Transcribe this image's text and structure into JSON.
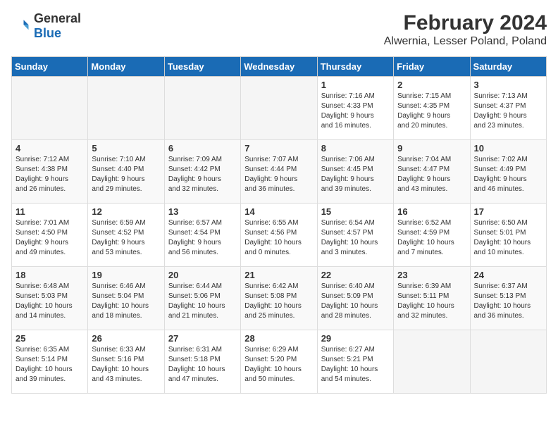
{
  "logo": {
    "text_general": "General",
    "text_blue": "Blue"
  },
  "title": "February 2024",
  "subtitle": "Alwernia, Lesser Poland, Poland",
  "days_of_week": [
    "Sunday",
    "Monday",
    "Tuesday",
    "Wednesday",
    "Thursday",
    "Friday",
    "Saturday"
  ],
  "weeks": [
    [
      {
        "day": "",
        "info": ""
      },
      {
        "day": "",
        "info": ""
      },
      {
        "day": "",
        "info": ""
      },
      {
        "day": "",
        "info": ""
      },
      {
        "day": "1",
        "info": "Sunrise: 7:16 AM\nSunset: 4:33 PM\nDaylight: 9 hours\nand 16 minutes."
      },
      {
        "day": "2",
        "info": "Sunrise: 7:15 AM\nSunset: 4:35 PM\nDaylight: 9 hours\nand 20 minutes."
      },
      {
        "day": "3",
        "info": "Sunrise: 7:13 AM\nSunset: 4:37 PM\nDaylight: 9 hours\nand 23 minutes."
      }
    ],
    [
      {
        "day": "4",
        "info": "Sunrise: 7:12 AM\nSunset: 4:38 PM\nDaylight: 9 hours\nand 26 minutes."
      },
      {
        "day": "5",
        "info": "Sunrise: 7:10 AM\nSunset: 4:40 PM\nDaylight: 9 hours\nand 29 minutes."
      },
      {
        "day": "6",
        "info": "Sunrise: 7:09 AM\nSunset: 4:42 PM\nDaylight: 9 hours\nand 32 minutes."
      },
      {
        "day": "7",
        "info": "Sunrise: 7:07 AM\nSunset: 4:44 PM\nDaylight: 9 hours\nand 36 minutes."
      },
      {
        "day": "8",
        "info": "Sunrise: 7:06 AM\nSunset: 4:45 PM\nDaylight: 9 hours\nand 39 minutes."
      },
      {
        "day": "9",
        "info": "Sunrise: 7:04 AM\nSunset: 4:47 PM\nDaylight: 9 hours\nand 43 minutes."
      },
      {
        "day": "10",
        "info": "Sunrise: 7:02 AM\nSunset: 4:49 PM\nDaylight: 9 hours\nand 46 minutes."
      }
    ],
    [
      {
        "day": "11",
        "info": "Sunrise: 7:01 AM\nSunset: 4:50 PM\nDaylight: 9 hours\nand 49 minutes."
      },
      {
        "day": "12",
        "info": "Sunrise: 6:59 AM\nSunset: 4:52 PM\nDaylight: 9 hours\nand 53 minutes."
      },
      {
        "day": "13",
        "info": "Sunrise: 6:57 AM\nSunset: 4:54 PM\nDaylight: 9 hours\nand 56 minutes."
      },
      {
        "day": "14",
        "info": "Sunrise: 6:55 AM\nSunset: 4:56 PM\nDaylight: 10 hours\nand 0 minutes."
      },
      {
        "day": "15",
        "info": "Sunrise: 6:54 AM\nSunset: 4:57 PM\nDaylight: 10 hours\nand 3 minutes."
      },
      {
        "day": "16",
        "info": "Sunrise: 6:52 AM\nSunset: 4:59 PM\nDaylight: 10 hours\nand 7 minutes."
      },
      {
        "day": "17",
        "info": "Sunrise: 6:50 AM\nSunset: 5:01 PM\nDaylight: 10 hours\nand 10 minutes."
      }
    ],
    [
      {
        "day": "18",
        "info": "Sunrise: 6:48 AM\nSunset: 5:03 PM\nDaylight: 10 hours\nand 14 minutes."
      },
      {
        "day": "19",
        "info": "Sunrise: 6:46 AM\nSunset: 5:04 PM\nDaylight: 10 hours\nand 18 minutes."
      },
      {
        "day": "20",
        "info": "Sunrise: 6:44 AM\nSunset: 5:06 PM\nDaylight: 10 hours\nand 21 minutes."
      },
      {
        "day": "21",
        "info": "Sunrise: 6:42 AM\nSunset: 5:08 PM\nDaylight: 10 hours\nand 25 minutes."
      },
      {
        "day": "22",
        "info": "Sunrise: 6:40 AM\nSunset: 5:09 PM\nDaylight: 10 hours\nand 28 minutes."
      },
      {
        "day": "23",
        "info": "Sunrise: 6:39 AM\nSunset: 5:11 PM\nDaylight: 10 hours\nand 32 minutes."
      },
      {
        "day": "24",
        "info": "Sunrise: 6:37 AM\nSunset: 5:13 PM\nDaylight: 10 hours\nand 36 minutes."
      }
    ],
    [
      {
        "day": "25",
        "info": "Sunrise: 6:35 AM\nSunset: 5:14 PM\nDaylight: 10 hours\nand 39 minutes."
      },
      {
        "day": "26",
        "info": "Sunrise: 6:33 AM\nSunset: 5:16 PM\nDaylight: 10 hours\nand 43 minutes."
      },
      {
        "day": "27",
        "info": "Sunrise: 6:31 AM\nSunset: 5:18 PM\nDaylight: 10 hours\nand 47 minutes."
      },
      {
        "day": "28",
        "info": "Sunrise: 6:29 AM\nSunset: 5:20 PM\nDaylight: 10 hours\nand 50 minutes."
      },
      {
        "day": "29",
        "info": "Sunrise: 6:27 AM\nSunset: 5:21 PM\nDaylight: 10 hours\nand 54 minutes."
      },
      {
        "day": "",
        "info": ""
      },
      {
        "day": "",
        "info": ""
      }
    ]
  ]
}
